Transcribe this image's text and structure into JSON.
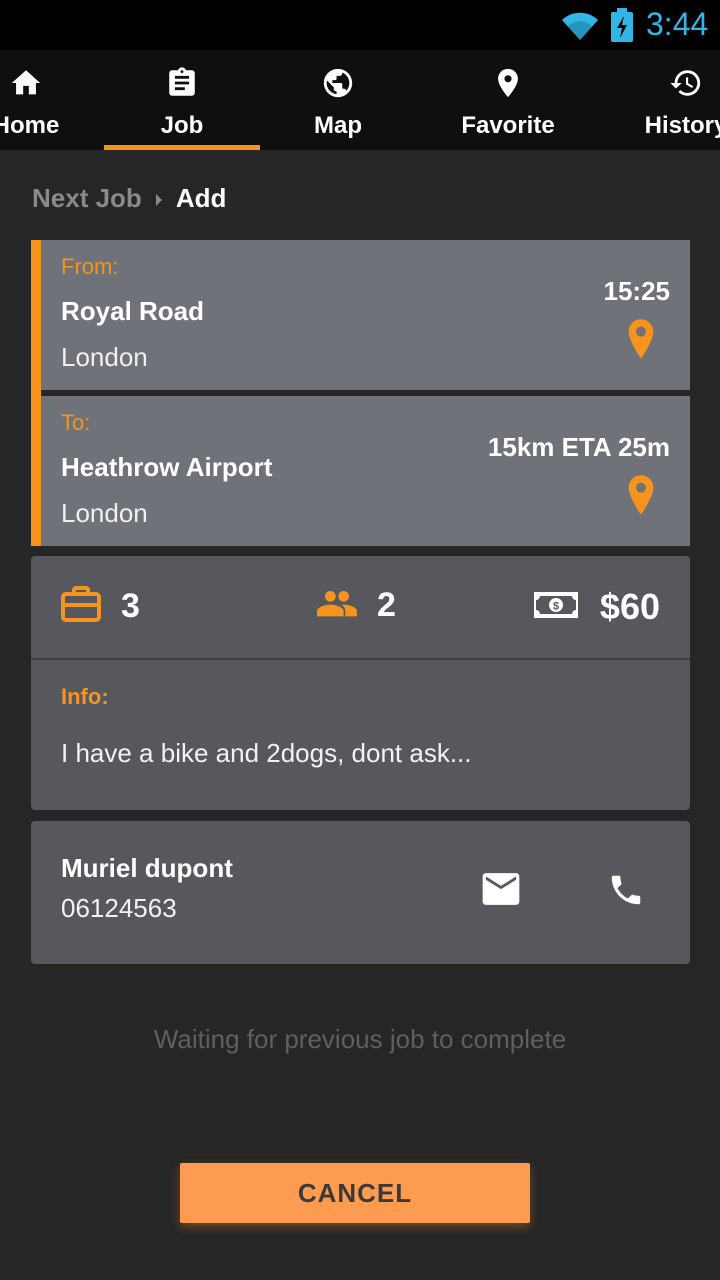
{
  "status_bar": {
    "time": "3:44",
    "wifi_icon": "wifi-icon",
    "battery_icon": "battery-charging-icon"
  },
  "tabs": [
    {
      "label": "Home",
      "icon": "home-icon",
      "active": false
    },
    {
      "label": "Job",
      "icon": "clipboard-icon",
      "active": true
    },
    {
      "label": "Map",
      "icon": "globe-icon",
      "active": false
    },
    {
      "label": "Favorite",
      "icon": "map-pin-icon",
      "active": false
    },
    {
      "label": "History",
      "icon": "history-icon",
      "active": false
    }
  ],
  "breadcrumb": {
    "parent": "Next Job",
    "current": "Add"
  },
  "route": {
    "from": {
      "label": "From:",
      "place": "Royal Road",
      "city": "London",
      "meta": "15:25"
    },
    "to": {
      "label": "To:",
      "place": "Heathrow Airport",
      "city": "London",
      "meta": "15km ETA 25m"
    }
  },
  "details": {
    "luggage": "3",
    "passengers": "2",
    "price": "$60",
    "info_label": "Info:",
    "info_text": "I have a bike and 2dogs, dont ask..."
  },
  "contact": {
    "name": "Muriel dupont",
    "phone": "06124563"
  },
  "status_message": "Waiting for previous job to complete",
  "actions": {
    "cancel_label": "CANCEL"
  },
  "colors": {
    "accent": "#f7941d",
    "clock": "#33b5e5",
    "card": "#56585d",
    "leg": "#6f7278",
    "button": "#fd9b51"
  }
}
